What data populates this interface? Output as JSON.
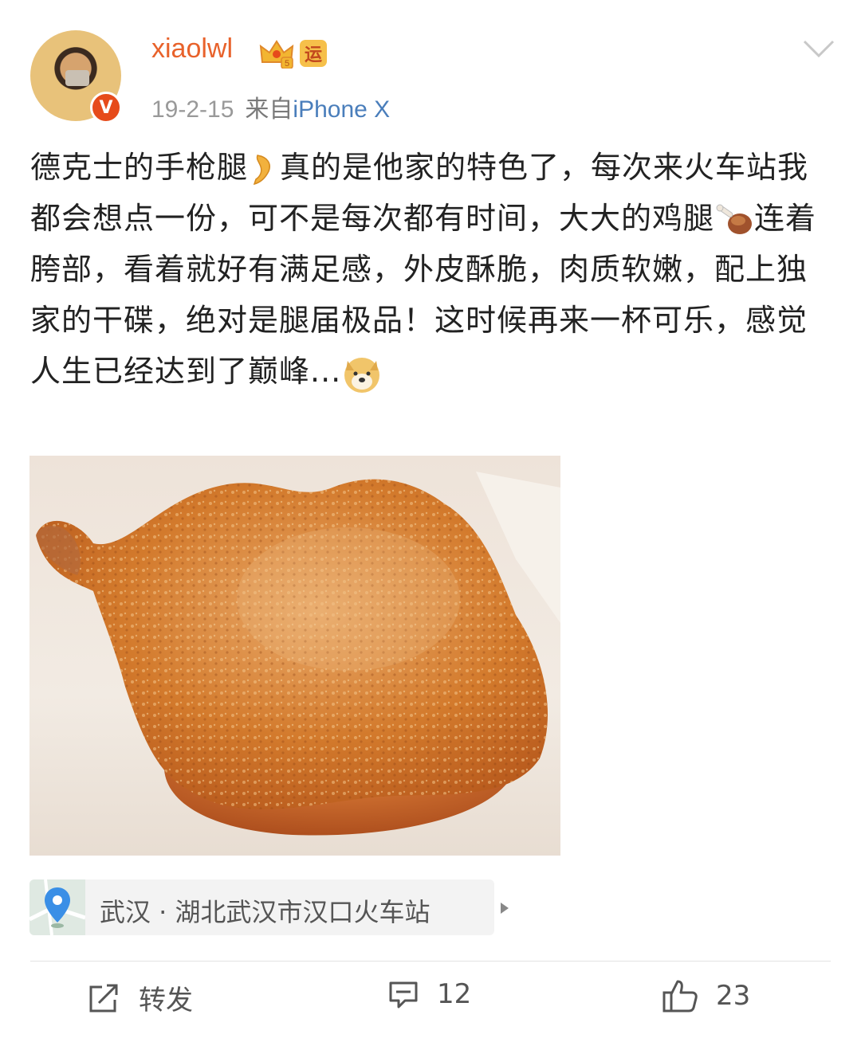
{
  "user": {
    "name": "xiaolwl",
    "verified_mark": "V",
    "badge_text": "运"
  },
  "meta": {
    "date": "19-2-15",
    "source_prefix": "来自",
    "device": "iPhone X"
  },
  "post": {
    "segments": [
      "德克士的手枪腿",
      "真的是他家的特色了，每次来火车站我都会想点一份，可不是每次都有时间，大大的鸡腿",
      "连着胯部，看着就好有满足感，外皮酥脆，肉质软嫩，配上独家的干碟，绝对是腿届极品！这时候再来一杯可乐，感觉人生已经达到了巅峰..."
    ],
    "emojis": [
      "leg-emoji",
      "drumstick-emoji",
      "doge-emoji"
    ]
  },
  "location": {
    "text": "武汉 · 湖北武汉市汉口火车站"
  },
  "actions": {
    "repost_label": "转发",
    "comment_count": "12",
    "like_count": "23"
  },
  "colors": {
    "username": "#e8622b",
    "device_link": "#4a7ebb",
    "verified": "#e64b1b"
  }
}
